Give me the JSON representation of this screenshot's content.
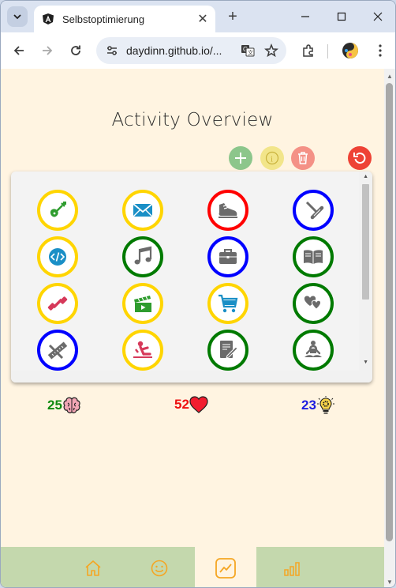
{
  "browser": {
    "tab_title": "Selbstoptimierung",
    "url": "daydinn.github.io/...",
    "icons": [
      "tab-search-icon",
      "angular-favicon",
      "close-icon",
      "new-tab-icon",
      "minimize-icon",
      "maximize-icon",
      "window-close-icon",
      "back-icon",
      "forward-icon",
      "reload-icon",
      "site-settings-icon",
      "translate-icon",
      "bookmark-star-icon",
      "extensions-icon",
      "profile-avatar-icon",
      "kebab-menu-icon"
    ]
  },
  "page": {
    "title": "Activity Overview",
    "actions": [
      {
        "name": "add-activity-button",
        "icon": "plus-icon",
        "color": "#8cc68b"
      },
      {
        "name": "info-button",
        "icon": "info-icon",
        "color": "#f2e58a"
      },
      {
        "name": "delete-button",
        "icon": "trash-icon",
        "color": "#f49186"
      },
      {
        "name": "reset-button",
        "icon": "undo-icon",
        "color": "#ee4235"
      }
    ],
    "activities": [
      {
        "icon": "guitar-icon",
        "border": "#ffd500"
      },
      {
        "icon": "mail-icon",
        "border": "#ffd500"
      },
      {
        "icon": "running-shoe-icon",
        "border": "#ff0000"
      },
      {
        "icon": "squeegee-cleaning-icon",
        "border": "#0000ff"
      },
      {
        "icon": "code-icon",
        "border": "#ffd500"
      },
      {
        "icon": "music-note-icon",
        "border": "#007a00"
      },
      {
        "icon": "briefcase-icon",
        "border": "#0000ff"
      },
      {
        "icon": "open-book-icon",
        "border": "#007a00"
      },
      {
        "icon": "dumbbell-icon",
        "border": "#ffd500"
      },
      {
        "icon": "clapperboard-icon",
        "border": "#ffd500"
      },
      {
        "icon": "shopping-cart-icon",
        "border": "#ffd500"
      },
      {
        "icon": "hearts-icon",
        "border": "#007a00"
      },
      {
        "icon": "ruler-pencil-icon",
        "border": "#0000ff"
      },
      {
        "icon": "sit-up-icon",
        "border": "#ffd500"
      },
      {
        "icon": "writing-icon",
        "border": "#007a00"
      },
      {
        "icon": "meditation-icon",
        "border": "#007a00"
      }
    ],
    "stats": [
      {
        "value": "25",
        "icon": "brain-icon",
        "color": "#0f8a0f"
      },
      {
        "value": "52",
        "icon": "heart-icon",
        "color": "#ee1111"
      },
      {
        "value": "23",
        "icon": "lightbulb-gear-icon",
        "color": "#1d1de0"
      }
    ],
    "nav": [
      {
        "name": "nav-home",
        "icon": "home-icon",
        "active": false
      },
      {
        "name": "nav-mood",
        "icon": "smiley-icon",
        "active": false
      },
      {
        "name": "nav-activity",
        "icon": "trend-chart-icon",
        "active": true
      },
      {
        "name": "nav-stats",
        "icon": "bar-chart-icon",
        "active": false
      }
    ],
    "accent": "#f5a623"
  }
}
